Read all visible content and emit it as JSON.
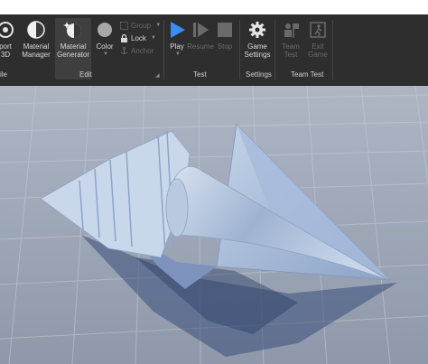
{
  "ribbon": {
    "buttons": {
      "import_3d": {
        "line1": "port",
        "line2": "3D",
        "icon": "import-3d-icon"
      },
      "material_manager": {
        "line1": "Material",
        "line2": "Manager",
        "icon": "material-manager-icon"
      },
      "material_generator": {
        "line1": "Material",
        "line2": "Generator",
        "icon": "material-generator-icon"
      },
      "color": {
        "line1": "Color",
        "icon": "color-swatch-icon"
      },
      "play": {
        "line1": "Play",
        "icon": "play-icon"
      },
      "resume": {
        "line1": "Resume",
        "icon": "resume-icon"
      },
      "stop": {
        "line1": "Stop",
        "icon": "stop-icon"
      },
      "game_settings": {
        "line1": "Game",
        "line2": "Settings",
        "icon": "gear-icon"
      },
      "team_test": {
        "line1": "Team",
        "line2": "Test",
        "icon": "team-test-icon"
      },
      "exit_game": {
        "line1": "Exit",
        "line2": "Game",
        "icon": "exit-game-icon"
      }
    },
    "small": {
      "group": "Group",
      "lock": "Lock",
      "anchor": "Anchor"
    },
    "groups": {
      "file": "ile",
      "edit": "Edit",
      "test": "Test",
      "settings": "Settings",
      "team_test": "Team Test"
    }
  },
  "colors": {
    "ribbon_bg": "#2e2e2e",
    "play_accent": "#3a8df0",
    "viewport_floor": "#9aa3b4",
    "part_color": "#b7c6dd"
  }
}
